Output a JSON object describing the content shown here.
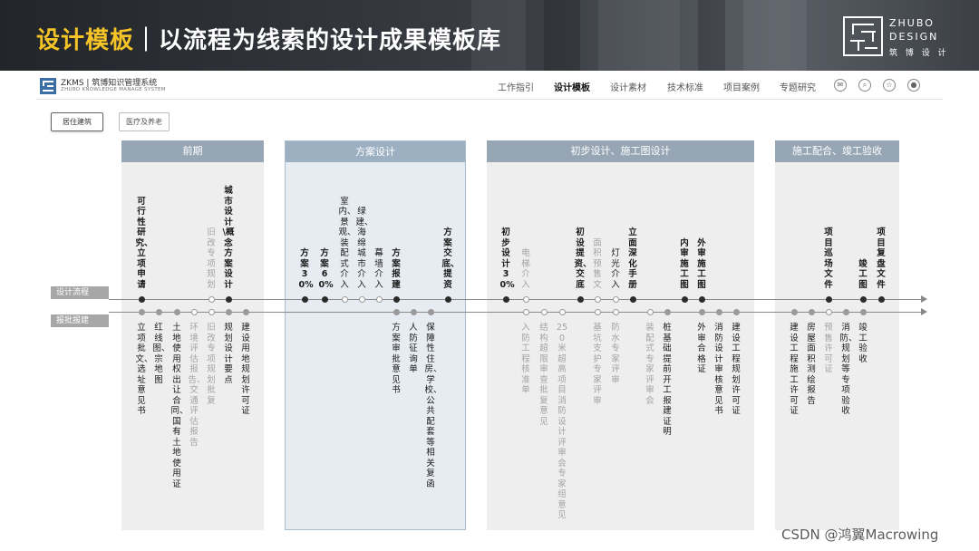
{
  "banner": {
    "title_accent": "设计模板",
    "title_rest": "｜以流程为线索的设计成果模板库",
    "brand_en1": "ZHUBO",
    "brand_en2": "DESIGN",
    "brand_cn": "筑 博 设 计"
  },
  "app": {
    "name": "ZKMS | 筑博知识管理系统",
    "subtitle": "ZHUBO KNOWLEDGE MANAGE SYSTEM"
  },
  "nav": {
    "items": [
      "工作指引",
      "设计模板",
      "设计素材",
      "技术标准",
      "项目案例",
      "专题研究"
    ],
    "active": "设计模板",
    "icons": [
      "comment-icon",
      "search-icon",
      "star-icon",
      "user-icon"
    ]
  },
  "filters": {
    "active": "居住建筑",
    "other": "医疗及养老"
  },
  "phases": [
    "前期",
    "方案设计",
    "初步设计、施工图设计",
    "施工配合、竣工验收"
  ],
  "lanes": {
    "design": "设计流程",
    "approval": "报批报建"
  },
  "design_nodes": [
    {
      "text": "可行性研究、立项申请",
      "style": "bold",
      "dot": "b"
    },
    {
      "text": "旧改专项规划",
      "style": "gray",
      "dot": "o"
    },
    {
      "text": "城市设计\\概念方案设计",
      "style": "bold",
      "dot": "b"
    },
    {
      "text": "方案30%",
      "style": "bold",
      "dot": "b"
    },
    {
      "text": "方案60%",
      "style": "bold",
      "dot": "b"
    },
    {
      "text": "室内、景观、装配式介入",
      "style": "normal",
      "dot": "o"
    },
    {
      "text": "绿建、海绵城市介入",
      "style": "normal",
      "dot": "o"
    },
    {
      "text": "幕墙介入",
      "style": "normal",
      "dot": "o"
    },
    {
      "text": "方案报建",
      "style": "bold",
      "dot": "b"
    },
    {
      "text": "方案交底、提资",
      "style": "bold",
      "dot": "b"
    },
    {
      "text": "初步设计30%",
      "style": "bold",
      "dot": "b"
    },
    {
      "text": "电梯介入",
      "style": "gray",
      "dot": "o"
    },
    {
      "text": "初设提资、交底",
      "style": "bold",
      "dot": "b"
    },
    {
      "text": "面积预售文",
      "style": "gray",
      "dot": "o"
    },
    {
      "text": "灯光介入",
      "style": "normal",
      "dot": "o"
    },
    {
      "text": "立面深化手册",
      "style": "bold",
      "dot": "b"
    },
    {
      "text": "内审施工图",
      "style": "bold",
      "dot": "b"
    },
    {
      "text": "外审施工图",
      "style": "bold",
      "dot": "b"
    },
    {
      "text": "项目巡场文件",
      "style": "bold",
      "dot": "b"
    },
    {
      "text": "竣工图",
      "style": "bold",
      "dot": "b"
    },
    {
      "text": "项目复盘文件",
      "style": "bold",
      "dot": "b"
    }
  ],
  "approval_nodes": [
    {
      "text": "立项批文、选址意见书",
      "style": "normal",
      "dot": "g"
    },
    {
      "text": "红线图、宗地图",
      "style": "normal",
      "dot": "g"
    },
    {
      "text": "土地使用权出让合同、国有土地使用证",
      "style": "normal",
      "dot": "g"
    },
    {
      "text": "环境评估报告、交通评估报告",
      "style": "gray",
      "dot": "o"
    },
    {
      "text": "旧改专项规划批复",
      "style": "gray",
      "dot": "o"
    },
    {
      "text": "规划设计要点",
      "style": "normal",
      "dot": "g"
    },
    {
      "text": "建设用地规划许可证",
      "style": "normal",
      "dot": "g"
    },
    {
      "text": "方案审批意见书",
      "style": "normal",
      "dot": "g"
    },
    {
      "text": "人防征询单",
      "style": "normal",
      "dot": "g"
    },
    {
      "text": "保障性住房、学校、公共配套等相关复函",
      "style": "normal",
      "dot": "g"
    },
    {
      "text": "入防工程核准单",
      "style": "gray",
      "dot": "o"
    },
    {
      "text": "结构超限审查批复意见",
      "style": "gray",
      "dot": "o"
    },
    {
      "text": "250米超高项目消防设计评审会专家组意见",
      "style": "gray",
      "dot": "o"
    },
    {
      "text": "基坑支护专家评审",
      "style": "gray",
      "dot": "o"
    },
    {
      "text": "防水专家评审",
      "style": "gray",
      "dot": "o"
    },
    {
      "text": "装配式专家评审会",
      "style": "gray",
      "dot": "o"
    },
    {
      "text": "桩基础提前开工报建证明",
      "style": "normal",
      "dot": "g"
    },
    {
      "text": "外审合格证",
      "style": "normal",
      "dot": "g"
    },
    {
      "text": "消防设计审核意见书",
      "style": "normal",
      "dot": "g"
    },
    {
      "text": "建设工程规划许可证",
      "style": "normal",
      "dot": "g"
    },
    {
      "text": "建设工程施工许可证",
      "style": "normal",
      "dot": "g"
    },
    {
      "text": "房屋面积测绘报告",
      "style": "normal",
      "dot": "g"
    },
    {
      "text": "预售许可证",
      "style": "gray",
      "dot": "o"
    },
    {
      "text": "消防、规划等专项验收",
      "style": "normal",
      "dot": "g"
    },
    {
      "text": "竣工验收",
      "style": "normal",
      "dot": "g"
    }
  ],
  "watermark": "CSDN @鸿翼Macrowing"
}
